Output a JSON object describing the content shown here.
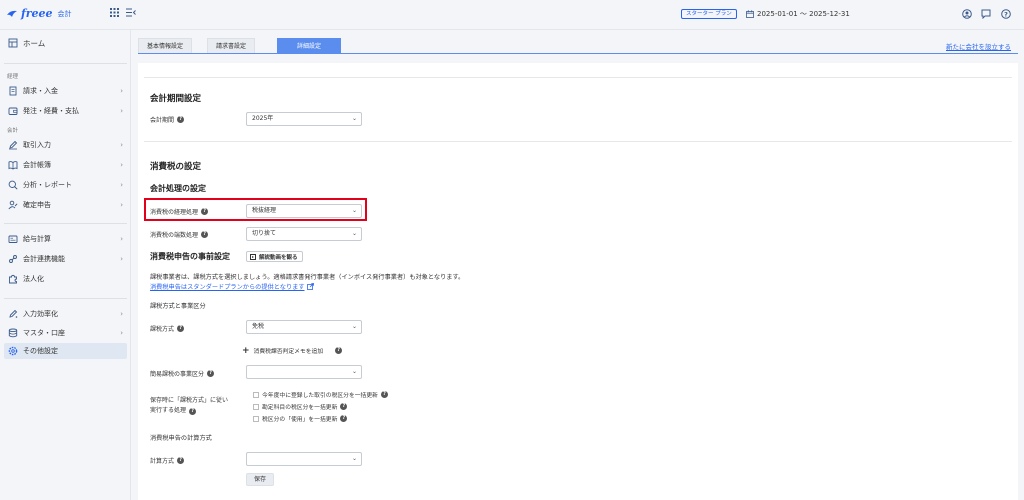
{
  "header": {
    "brand": "freee",
    "product": "会計",
    "plan": "スターター プラン",
    "period": "2025-01-01 ～ 2025-12-31"
  },
  "sidebar": {
    "home": "ホーム",
    "section_keiri": "経理",
    "section_kaikei": "会計",
    "items": [
      {
        "label": "請求・入金"
      },
      {
        "label": "発注・経費・支払"
      },
      {
        "label": "取引入力"
      },
      {
        "label": "会計帳簿"
      },
      {
        "label": "分析・レポート"
      },
      {
        "label": "確定申告"
      },
      {
        "label": "給与計算"
      },
      {
        "label": "会計連携機能"
      },
      {
        "label": "法人化"
      },
      {
        "label": "入力効率化"
      },
      {
        "label": "マスタ・口座"
      },
      {
        "label": "その他設定"
      }
    ]
  },
  "tabs": [
    {
      "label": "基本情報設定"
    },
    {
      "label": "請求書設定"
    },
    {
      "label": "詳細設定"
    }
  ],
  "new_company_link": "新たに会社を設立する",
  "fiscal": {
    "title": "会計期間設定",
    "label": "会計期間",
    "value": "2025年"
  },
  "tax": {
    "title": "消費税の設定",
    "subtitle": "会計処理の設定",
    "method_label": "消費税の経理処理",
    "method_value": "税抜経理",
    "rounding_label": "消費税の端数処理",
    "rounding_value": "切り捨て",
    "prefiling_title": "消費税申告の事前設定",
    "video_button": "解説動画を観る",
    "description": "課税事業者は、課税方式を選択しましょう。適格請求書発行事業者（インボイス発行事業者）も対象となります。",
    "link": "消費税申告はスタンダードプランからの提供となります",
    "section1": "課税方式と事業区分",
    "taxation_label": "課税方式",
    "taxation_value": "免税",
    "add_memo": "消費税課否判定メモを追加",
    "business_category_label": "簡易課税の事業区分",
    "business_category_value": "",
    "on_save_label_1": "保存時に「課税方式」に従い",
    "on_save_label_2": "実行する処理",
    "checks": [
      {
        "label": "今年度中に登録した取引の税区分を一括更新"
      },
      {
        "label": "勘定科目の税区分を一括更新"
      },
      {
        "label": "税区分の「使用」を一括更新"
      }
    ],
    "section2": "消費税申告の計算方式",
    "calc_label": "計算方式",
    "calc_value": "",
    "save_button": "保存"
  }
}
